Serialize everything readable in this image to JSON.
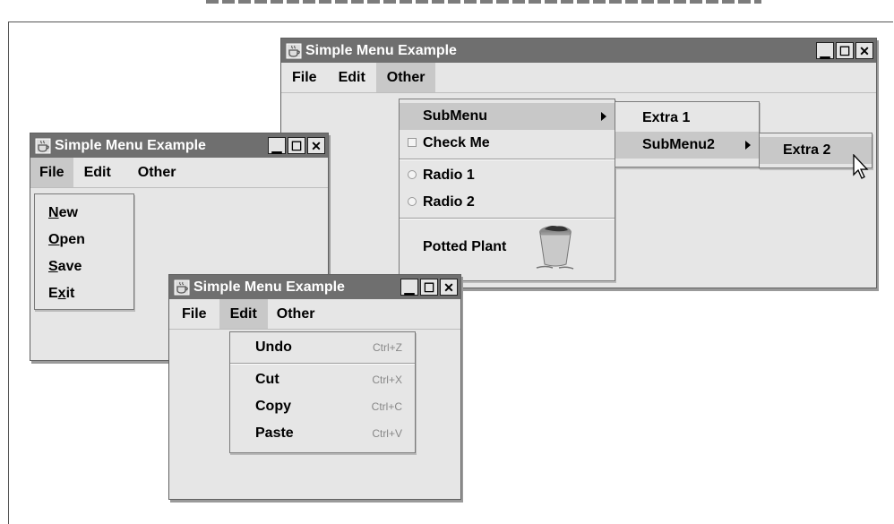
{
  "window_title": "Simple Menu Example",
  "menus": [
    "File",
    "Edit",
    "Other"
  ],
  "window_buttons": {
    "minimize": "▁",
    "maximize": "☐",
    "close": "✕"
  },
  "file_menu": {
    "items": [
      {
        "label": "New",
        "mnemonic": "N",
        "rest": "ew"
      },
      {
        "label": "Open",
        "mnemonic": "O",
        "rest": "pen"
      },
      {
        "label": "Save",
        "mnemonic": "S",
        "rest": "ave"
      },
      {
        "label": "Exit",
        "first": "E",
        "mnemonic": "x",
        "rest": "it"
      }
    ]
  },
  "edit_menu": {
    "items": [
      {
        "label": "Undo",
        "accel": "Ctrl+Z"
      },
      {
        "label": "Cut",
        "accel": "Ctrl+X"
      },
      {
        "label": "Copy",
        "accel": "Ctrl+C"
      },
      {
        "label": "Paste",
        "accel": "Ctrl+V"
      }
    ]
  },
  "other_menu": {
    "submenu": "SubMenu",
    "check": "Check Me",
    "radio1": "Radio 1",
    "radio2": "Radio 2",
    "potted": "Potted Plant"
  },
  "submenu1": {
    "extra1": "Extra 1",
    "submenu2": "SubMenu2"
  },
  "submenu2": {
    "extra2": "Extra 2"
  },
  "colors": {
    "titlebar": "#6f6f6f",
    "window": "#e6e6e6",
    "selection": "#c8c8c8"
  }
}
